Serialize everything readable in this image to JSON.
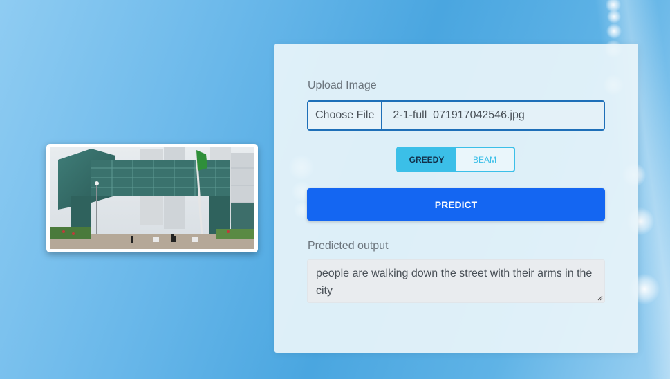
{
  "preview": {
    "alt_icon": "building-photo"
  },
  "form": {
    "upload_label": "Upload Image",
    "choose_file_label": "Choose File",
    "file_name": "2-1-full_071917042546.jpg",
    "modes": [
      {
        "label": "GREEDY",
        "selected": true
      },
      {
        "label": "BEAM",
        "selected": false
      }
    ],
    "predict_label": "PREDICT",
    "output_label": "Predicted output",
    "output_text": "people are walking down the street with their arms in the city"
  },
  "colors": {
    "primary": "#1466f2",
    "toggle_accent": "#3bbfe8",
    "file_border": "#1e6fb8"
  }
}
